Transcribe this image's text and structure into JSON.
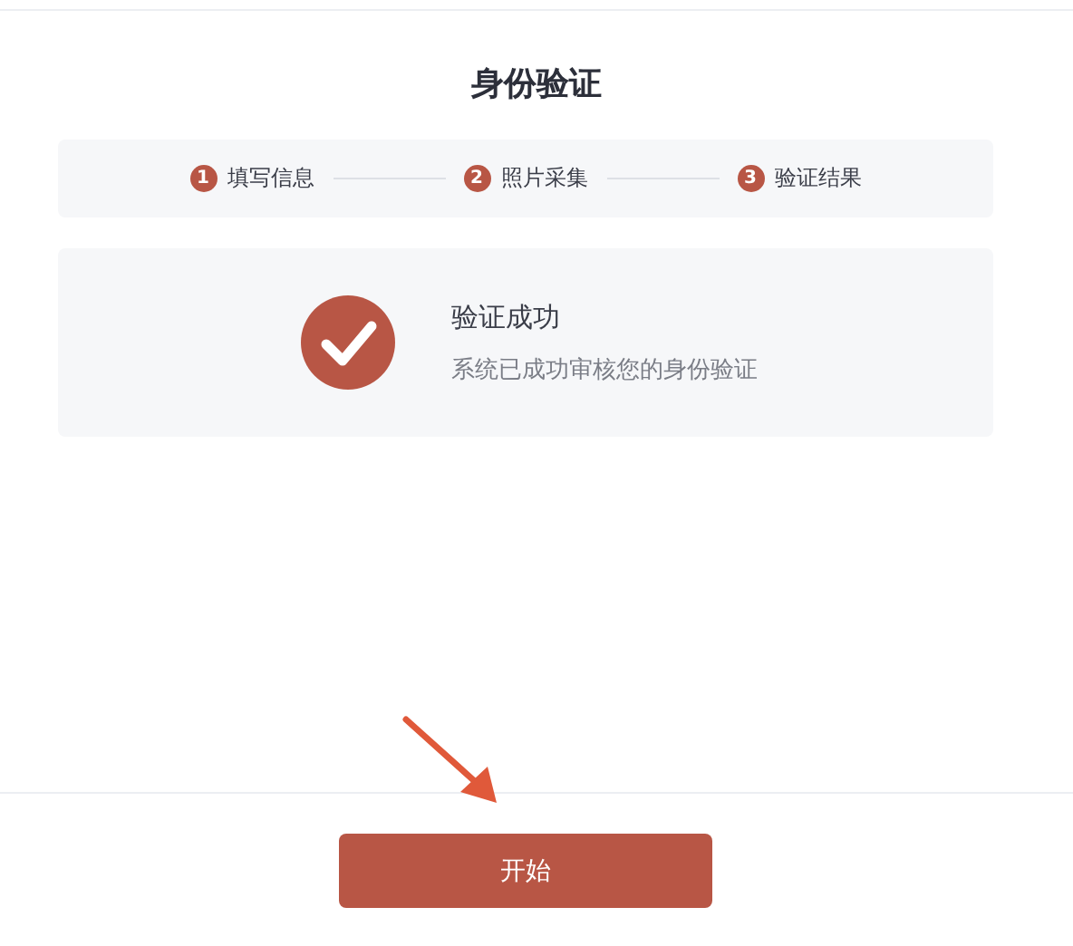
{
  "title": "身份验证",
  "steps": [
    {
      "number": "1",
      "label": "填写信息"
    },
    {
      "number": "2",
      "label": "照片采集"
    },
    {
      "number": "3",
      "label": "验证结果"
    }
  ],
  "result": {
    "kind": "success",
    "heading": "验证成功",
    "message": "系统已成功审核您的身份验证"
  },
  "button": {
    "label": "开始"
  }
}
